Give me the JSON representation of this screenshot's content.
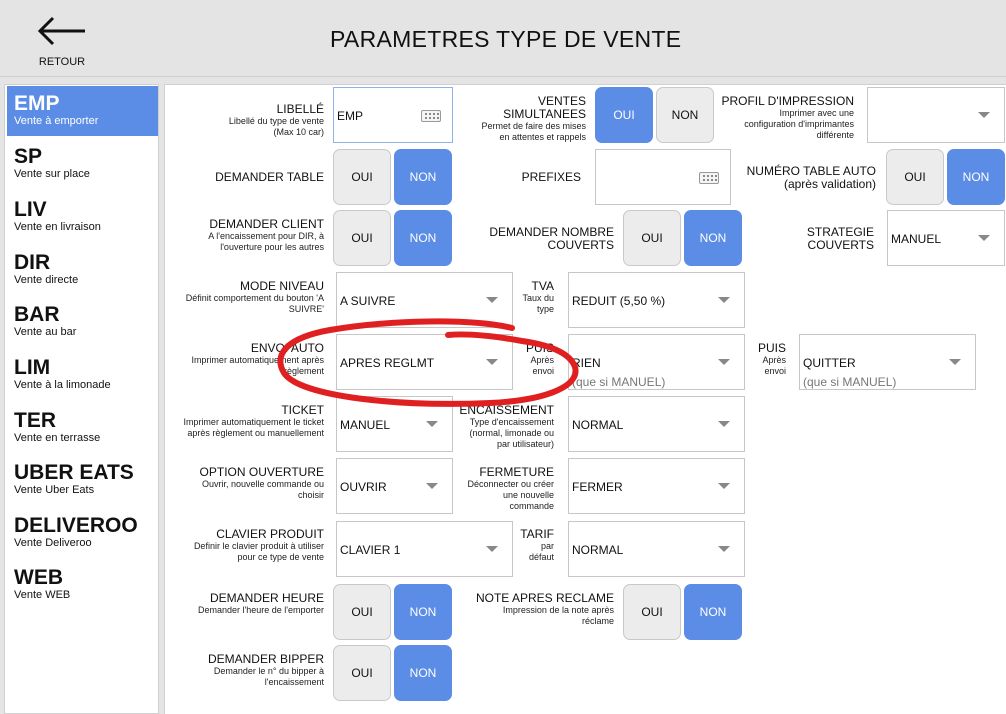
{
  "header": {
    "back_label": "RETOUR",
    "title": "PARAMETRES TYPE DE VENTE"
  },
  "sidebar": {
    "items": [
      {
        "code": "EMP",
        "label": "Vente à emporter",
        "active": true
      },
      {
        "code": "SP",
        "label": "Vente sur place"
      },
      {
        "code": "LIV",
        "label": "Vente en livraison"
      },
      {
        "code": "DIR",
        "label": "Vente directe"
      },
      {
        "code": "BAR",
        "label": "Vente au bar"
      },
      {
        "code": "LIM",
        "label": "Vente à la limonade"
      },
      {
        "code": "TER",
        "label": "Vente en terrasse"
      },
      {
        "code": "UBER EATS",
        "label": "Vente Uber Eats"
      },
      {
        "code": "DELIVEROO",
        "label": "Vente Deliveroo"
      },
      {
        "code": "WEB",
        "label": "Vente WEB"
      }
    ]
  },
  "form": {
    "libelle": {
      "title": "LIBELLÉ",
      "desc": "Libellé du type de vente",
      "desc2": "(Max 10 car)",
      "value": "EMP"
    },
    "ventes_simultanees": {
      "title": "VENTES",
      "title2": "SIMULTANEES",
      "desc": "Permet de faire des mises",
      "desc2": "en attentes et rappels",
      "oui": "OUI",
      "non": "NON",
      "selected": "OUI"
    },
    "profil_impression": {
      "title": "PROFIL D'IMPRESSION",
      "desc": "Imprimer avec une",
      "desc2": "configuration d'imprimantes",
      "desc3": "différente",
      "value": ""
    },
    "demander_table": {
      "title": "DEMANDER TABLE",
      "oui": "OUI",
      "non": "NON",
      "selected": "NON"
    },
    "prefixes": {
      "title": "PREFIXES",
      "value": ""
    },
    "numero_table_auto": {
      "title": "NUMÉRO TABLE AUTO",
      "title2": "(après validation)",
      "oui": "OUI",
      "non": "NON",
      "selected": "NON"
    },
    "demander_client": {
      "title": "DEMANDER CLIENT",
      "desc": "A l'encaissement pour DIR, à",
      "desc2": "l'ouverture pour les autres",
      "oui": "OUI",
      "non": "NON",
      "selected": "NON"
    },
    "demander_nombre_couverts": {
      "title": "DEMANDER NOMBRE",
      "title2": "COUVERTS",
      "oui": "OUI",
      "non": "NON",
      "selected": "NON"
    },
    "strategie_couverts": {
      "title": "STRATEGIE",
      "title2": "COUVERTS",
      "value": "MANUEL"
    },
    "mode_niveau": {
      "title": "MODE NIVEAU",
      "desc": "Définit comportement du bouton 'A",
      "desc2": "SUIVRE'",
      "value": "A SUIVRE"
    },
    "tva": {
      "title": "TVA",
      "desc": "Taux du",
      "desc2": "type",
      "value": "REDUIT (5,50 %)"
    },
    "envoi_auto": {
      "title": "ENVOI AUTO",
      "desc": "Imprimer automatiquement après",
      "desc2": "règlement",
      "value": "APRES REGLMT"
    },
    "puis_1": {
      "title": "PUIS",
      "desc": "Après",
      "desc2": "envoi",
      "value": "RIEN",
      "hint": "(que si MANUEL)"
    },
    "puis_2": {
      "title": "PUIS",
      "desc": "Après",
      "desc2": "envoi",
      "value": "QUITTER",
      "hint": "(que si MANUEL)"
    },
    "ticket": {
      "title": "TICKET",
      "desc": "Imprimer automatiquement le ticket",
      "desc2": "après règlement ou manuellement",
      "value": "MANUEL"
    },
    "encaissement": {
      "title": "ENCAISSEMENT",
      "desc": "Type d'encaissement",
      "desc2": "(normal, limonade ou",
      "desc3": "par utilisateur)",
      "value": "NORMAL"
    },
    "option_ouverture": {
      "title": "OPTION OUVERTURE",
      "desc": "Ouvrir, nouvelle commande ou",
      "desc2": "choisir",
      "value": "OUVRIR"
    },
    "fermeture": {
      "title": "FERMETURE",
      "desc": "Déconnecter ou créer",
      "desc2": "une nouvelle",
      "desc3": "commande",
      "value": "FERMER"
    },
    "clavier_produit": {
      "title": "CLAVIER PRODUIT",
      "desc": "Definir le clavier produit à utiliser",
      "desc2": "pour ce type de vente",
      "value": "CLAVIER 1"
    },
    "tarif": {
      "title": "TARIF",
      "desc": "par",
      "desc2": "défaut",
      "value": "NORMAL"
    },
    "demander_heure": {
      "title": "DEMANDER HEURE",
      "desc": "Demander l'heure de l'emporter",
      "oui": "OUI",
      "non": "NON",
      "selected": "NON"
    },
    "note_apres_reclame": {
      "title": "NOTE APRES RECLAME",
      "desc": "Impression de la note après",
      "desc2": "réclame",
      "oui": "OUI",
      "non": "NON",
      "selected": "NON"
    },
    "demander_bipper": {
      "title": "DEMANDER BIPPER",
      "desc": "Demander le n° du bipper à",
      "desc2": "l'encaissement",
      "oui": "OUI",
      "non": "NON",
      "selected": "NON"
    }
  },
  "colors": {
    "accent": "#5b8de6",
    "annotation": "#e02020"
  },
  "icons": {
    "back": "arrow-left-icon",
    "keyboard": "keyboard-icon",
    "dropdown": "chevron-down-icon"
  }
}
